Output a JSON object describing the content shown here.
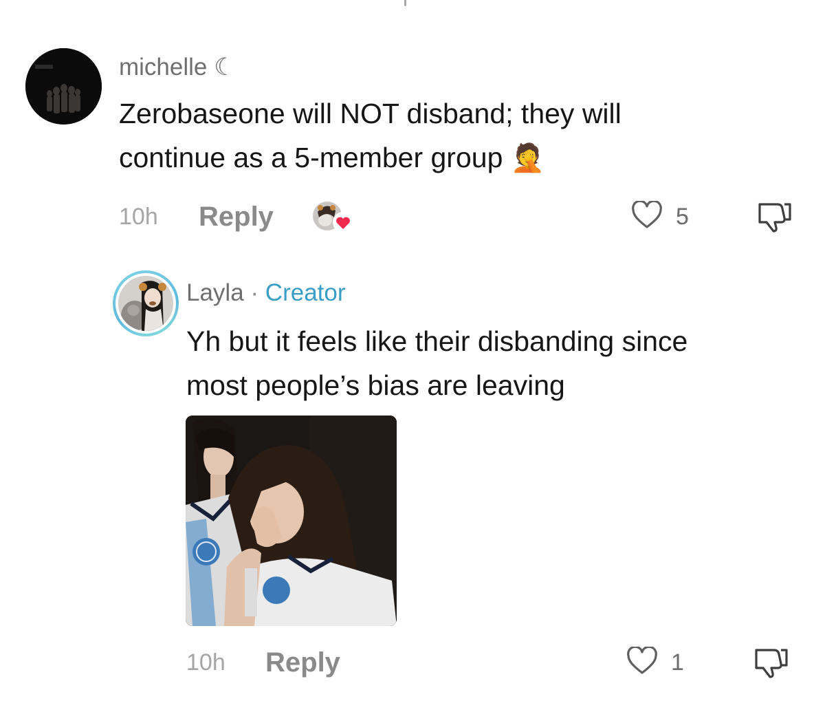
{
  "comment": {
    "username": "michelle",
    "username_suffix": "☾",
    "text_line1": "Zerobaseone will NOT disband; they will",
    "text_line2": "continue as a 5-member group",
    "emoji": "🤦",
    "time": "10h",
    "reply_label": "Reply",
    "like_count": "5"
  },
  "reply": {
    "username": "Layla",
    "separator": "·",
    "role": "Creator",
    "text_line1": "Yh but it feels like their disbanding since",
    "text_line2": "most people’s bias are leaving",
    "time": "10h",
    "reply_label": "Reply",
    "like_count": "1"
  },
  "colors": {
    "creator_accent": "#3a9dc6",
    "heart_badge": "#f0294f",
    "secondary_text": "#a5a5a5"
  },
  "icons": {
    "like": "heart-outline-icon",
    "dislike": "thumbs-down-icon",
    "liked_by_creator": "heart-badge-icon"
  }
}
